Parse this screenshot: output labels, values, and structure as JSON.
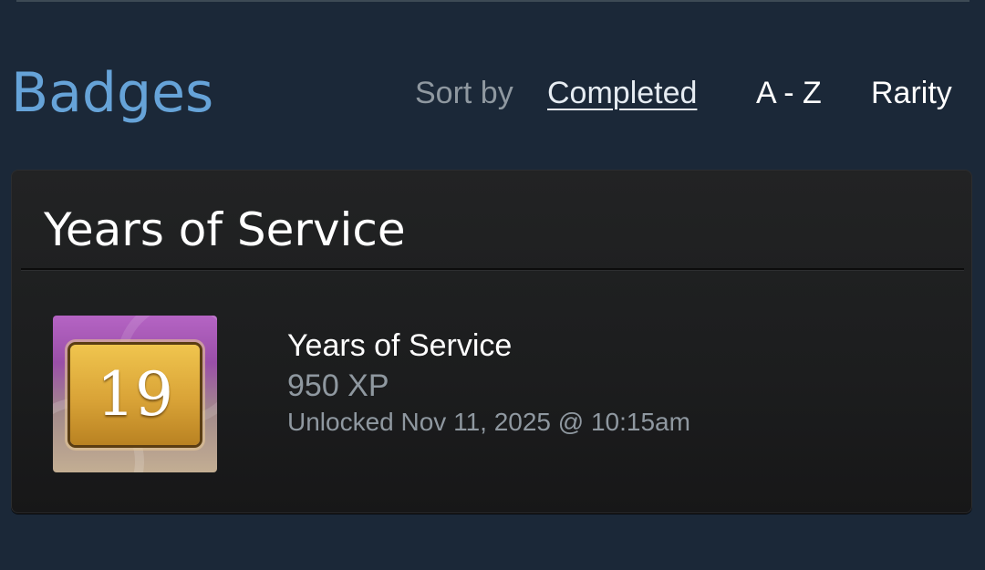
{
  "page": {
    "title": "Badges"
  },
  "sort": {
    "label": "Sort by",
    "options": [
      {
        "label": "Completed",
        "active": true
      },
      {
        "label": "A - Z",
        "active": false
      },
      {
        "label": "Rarity",
        "active": false
      }
    ]
  },
  "section": {
    "title": "Years of Service",
    "badge": {
      "icon": "years-of-service-badge-icon",
      "number": "19",
      "name": "Years of Service",
      "xp": "950 XP",
      "unlocked": "Unlocked Nov 11, 2025 @ 10:15am"
    }
  },
  "colors": {
    "background": "#1b2838",
    "title_accent": "#66a3d8",
    "muted_text": "#8f98a0",
    "card_bg": "#1f2021"
  }
}
